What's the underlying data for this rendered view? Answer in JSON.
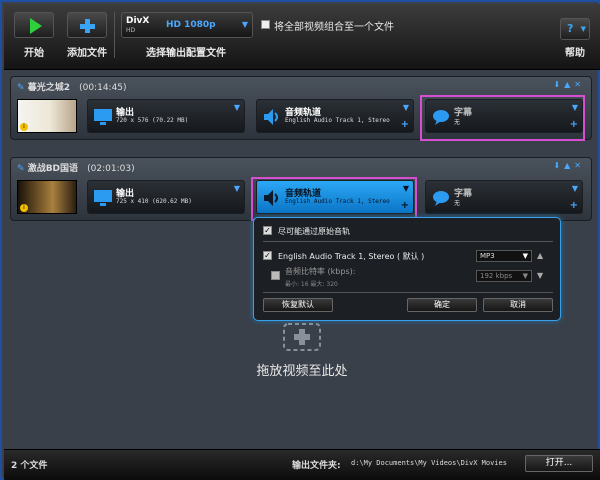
{
  "toolbar": {
    "start_label": "开始",
    "add_file_label": "添加文件",
    "profile_brand": "DivX",
    "profile_brand_sub": "HD",
    "profile_value": "HD 1080p",
    "profile_label": "选择输出配置文件",
    "combine_label": "将全部视频组合至一个文件",
    "help_label": "帮助",
    "help_icon": "?"
  },
  "rows": [
    {
      "title": "暮光之城2",
      "duration": "(00:14:45)",
      "output_title": "输出",
      "output_sub": "720 x 576 (70.22 MB)",
      "audio_title": "音频轨道",
      "audio_sub": "English Audio Track 1, Stereo",
      "subtitle_title": "字幕",
      "subtitle_sub": "无"
    },
    {
      "title": "激战BD国语",
      "duration": "(02:01:03)",
      "output_title": "输出",
      "output_sub": "725 x 410 (620.62 MB)",
      "audio_title": "音频轨道",
      "audio_sub": "English Audio Track 1, Stereo",
      "subtitle_title": "字幕",
      "subtitle_sub": "无"
    }
  ],
  "popup": {
    "pass_through_label": "尽可能通过原始音轨",
    "track_label": "English Audio Track 1, Stereo ( 默认 )",
    "codec_value": "MP3",
    "bitrate_label": "音频比特率 (kbps):",
    "bitrate_range": "最小: 16  最大: 320",
    "bitrate_value": "192 kbps",
    "reset_label": "恢复默认",
    "ok_label": "确定",
    "cancel_label": "取消"
  },
  "drop_zone_text": "拖放视频至此处",
  "footer": {
    "file_count": "2 个文件",
    "output_folder_label": "输出文件夹:",
    "output_folder_path": "d:\\My Documents\\My Videos\\DivX Movies",
    "open_label": "打开..."
  },
  "colors": {
    "accent": "#2a9bf0",
    "highlight": "#d64fd0",
    "background": "#3a4049"
  }
}
